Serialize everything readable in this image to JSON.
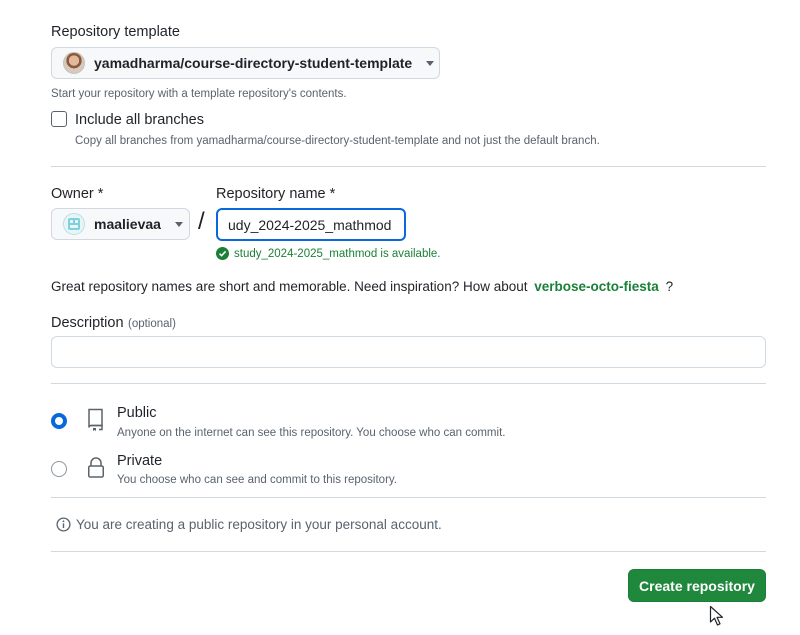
{
  "template": {
    "label": "Repository template",
    "selected": "yamadharma/course-directory-student-template",
    "hint": "Start your repository with a template repository's contents."
  },
  "branches": {
    "label": "Include all branches",
    "hint": "Copy all branches from yamadharma/course-directory-student-template and not just the default branch.",
    "checked": false
  },
  "owner": {
    "label": "Owner *",
    "value": "maalievaa"
  },
  "separator": "/",
  "repo_name": {
    "label": "Repository name *",
    "value": "udy_2024-2025_mathmod",
    "availability": "study_2024-2025_mathmod is available."
  },
  "inspiration": {
    "text": "Great repository names are short and memorable. Need inspiration? How about",
    "suggestion": "verbose-octo-fiesta",
    "suffix": "?"
  },
  "description": {
    "label": "Description",
    "optional": "(optional)",
    "value": ""
  },
  "visibility": {
    "selected": "public",
    "options": [
      {
        "id": "public",
        "title": "Public",
        "hint": "Anyone on the internet can see this repository. You choose who can commit."
      },
      {
        "id": "private",
        "title": "Private",
        "hint": "You choose who can see and commit to this repository."
      }
    ]
  },
  "notice": "You are creating a public repository in your personal account.",
  "submit": {
    "label": "Create repository"
  },
  "colors": {
    "accent": "#0969da",
    "success": "#1a7f37",
    "button": "#1f883d"
  }
}
